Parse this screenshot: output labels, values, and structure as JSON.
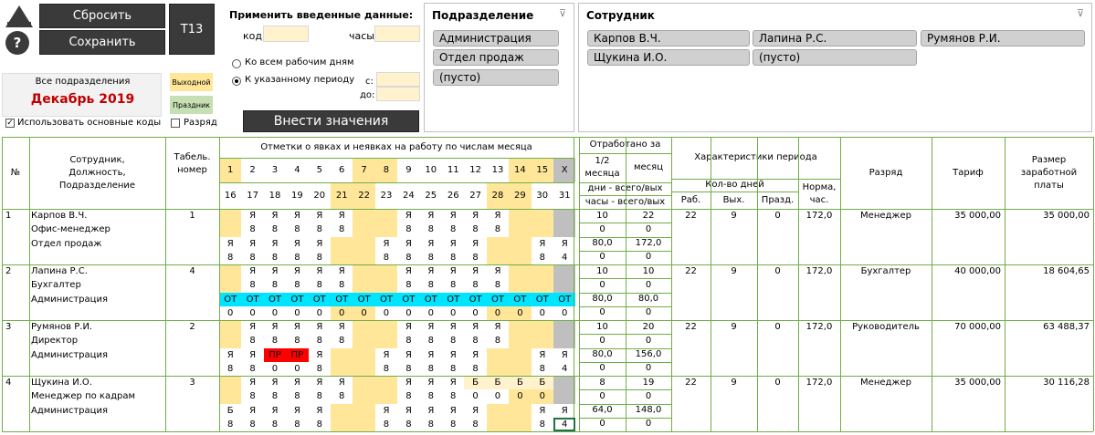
{
  "controls": {
    "reset_label": "Сбросить",
    "save_label": "Сохранить",
    "t13_label": "Т13",
    "help_label": "?"
  },
  "apply_panel": {
    "title": "Применить введенные данные:",
    "code_label": "код:",
    "hours_label": "часы:",
    "radio_all": "Ко всем рабочим дням",
    "radio_period": "К указанному периоду",
    "from_label": "с:",
    "to_label": "до:",
    "submit_label": "Внести значения"
  },
  "period_box": {
    "all_departments": "Все подразделения",
    "month": "Декабрь 2019",
    "weekend_label": "Выходной",
    "holiday_label": "Праздник",
    "use_codes_label": "Использовать основные коды",
    "use_codes_checked": true,
    "grade_label": "Разряд",
    "grade_checked": false
  },
  "department_slicer": {
    "title": "Подразделение",
    "items": [
      "Администрация",
      "Отдел продаж",
      "(пусто)"
    ]
  },
  "employee_slicer": {
    "title": "Сотрудник",
    "items": [
      "Карпов В.Ч.",
      "Лапина Р.С.",
      "Румянов Р.И.",
      "Щукина И.О.",
      "(пусто)"
    ]
  },
  "table": {
    "headers": {
      "num": "№",
      "employee": "Сотрудник,\nДолжность,\nПодразделение",
      "tab_num": "Табель.\nномер",
      "marks": "Отметки о явках и неявках на работу по числам месяца",
      "worked": "Отработано за",
      "half": "1/2\nмесяца",
      "month": "месяц",
      "days_total": "дни - всего/вых",
      "hours_total": "часы - всего/вых",
      "period": "Характеристики периода",
      "days_count": "Кол-во дней",
      "work": "Раб.",
      "off": "Вых.",
      "hol": "Празд.",
      "norm": "Норма,\nчас.",
      "grade": "Разряд",
      "tariff": "Тариф",
      "salary": "Размер\nзаработной\nплаты"
    },
    "days_row1": [
      "1",
      "2",
      "3",
      "4",
      "5",
      "6",
      "7",
      "8",
      "9",
      "10",
      "11",
      "12",
      "13",
      "14",
      "15",
      "X"
    ],
    "days_row2": [
      "16",
      "17",
      "18",
      "19",
      "20",
      "21",
      "22",
      "23",
      "24",
      "25",
      "26",
      "27",
      "28",
      "29",
      "30",
      "31"
    ],
    "employees": [
      {
        "num": "1",
        "name": "Карпов В.Ч.",
        "position": "Офис-менеджер",
        "department": "Отдел продаж",
        "tab": "1",
        "r1": [
          "",
          "Я",
          "Я",
          "Я",
          "Я",
          "Я",
          "",
          "",
          "Я",
          "Я",
          "Я",
          "Я",
          "Я",
          "",
          "",
          ""
        ],
        "r2": [
          "",
          "8",
          "8",
          "8",
          "8",
          "8",
          "",
          "",
          "8",
          "8",
          "8",
          "8",
          "8",
          "",
          "",
          ""
        ],
        "r3": [
          "Я",
          "Я",
          "Я",
          "Я",
          "Я",
          "",
          "",
          "Я",
          "Я",
          "Я",
          "Я",
          "Я",
          "",
          "",
          "Я",
          "Я"
        ],
        "r4": [
          "8",
          "8",
          "8",
          "8",
          "8",
          "",
          "",
          "8",
          "8",
          "8",
          "8",
          "8",
          "",
          "",
          "8",
          "4"
        ],
        "half_days": "10",
        "half_off": "0",
        "half_hours": "80,0",
        "half_hours_off": "0",
        "month_days": "22",
        "month_off": "0",
        "month_hours": "172,0",
        "month_hours_off": "0",
        "work": "22",
        "off": "9",
        "hol": "0",
        "norm": "172,0",
        "grade": "Менеджер",
        "tariff": "35 000,00",
        "salary": "35 000,00"
      },
      {
        "num": "2",
        "name": "Лапина Р.С.",
        "position": "Бухгалтер",
        "department": "Администрация",
        "tab": "4",
        "r1": [
          "",
          "Я",
          "Я",
          "Я",
          "Я",
          "Я",
          "",
          "",
          "Я",
          "Я",
          "Я",
          "Я",
          "Я",
          "",
          "",
          ""
        ],
        "r2": [
          "",
          "8",
          "8",
          "8",
          "8",
          "8",
          "",
          "",
          "8",
          "8",
          "8",
          "8",
          "8",
          "",
          "",
          ""
        ],
        "r3": [
          "ОТ",
          "ОТ",
          "ОТ",
          "ОТ",
          "ОТ",
          "ОТ",
          "ОТ",
          "ОТ",
          "ОТ",
          "ОТ",
          "ОТ",
          "ОТ",
          "ОТ",
          "ОТ",
          "ОТ",
          "ОТ"
        ],
        "r4": [
          "0",
          "0",
          "0",
          "0",
          "0",
          "0",
          "0",
          "0",
          "0",
          "0",
          "0",
          "0",
          "0",
          "0",
          "0",
          "0"
        ],
        "half_days": "10",
        "half_off": "0",
        "half_hours": "80,0",
        "half_hours_off": "0",
        "month_days": "10",
        "month_off": "0",
        "month_hours": "80,0",
        "month_hours_off": "0",
        "work": "22",
        "off": "9",
        "hol": "0",
        "norm": "172,0",
        "grade": "Бухгалтер",
        "tariff": "40 000,00",
        "salary": "18 604,65"
      },
      {
        "num": "3",
        "name": "Румянов Р.И.",
        "position": "Директор",
        "department": "Администрация",
        "tab": "2",
        "r1": [
          "",
          "Я",
          "Я",
          "Я",
          "Я",
          "Я",
          "",
          "",
          "Я",
          "Я",
          "Я",
          "Я",
          "Я",
          "",
          "",
          ""
        ],
        "r2": [
          "",
          "8",
          "8",
          "8",
          "8",
          "8",
          "",
          "",
          "8",
          "8",
          "8",
          "8",
          "8",
          "",
          "",
          ""
        ],
        "r3": [
          "Я",
          "Я",
          "ПР",
          "ПР",
          "Я",
          "",
          "",
          "Я",
          "Я",
          "Я",
          "Я",
          "Я",
          "",
          "",
          "Я",
          "Я"
        ],
        "r4": [
          "8",
          "8",
          "0",
          "0",
          "8",
          "",
          "",
          "8",
          "8",
          "8",
          "8",
          "8",
          "",
          "",
          "8",
          "4"
        ],
        "half_days": "10",
        "half_off": "0",
        "half_hours": "80,0",
        "half_hours_off": "0",
        "month_days": "20",
        "month_off": "0",
        "month_hours": "156,0",
        "month_hours_off": "0",
        "work": "22",
        "off": "9",
        "hol": "0",
        "norm": "172,0",
        "grade": "Руководитель",
        "tariff": "70 000,00",
        "salary": "63 488,37"
      },
      {
        "num": "4",
        "name": "Щукина И.О.",
        "position": "Менеджер по кадрам",
        "department": "Администрация",
        "tab": "3",
        "r1": [
          "",
          "Я",
          "Я",
          "Я",
          "Я",
          "Я",
          "",
          "",
          "Я",
          "Я",
          "Я",
          "Б",
          "Б",
          "Б",
          "Б",
          ""
        ],
        "r2": [
          "",
          "8",
          "8",
          "8",
          "8",
          "8",
          "",
          "",
          "8",
          "8",
          "8",
          "0",
          "0",
          "0",
          "0",
          ""
        ],
        "r3": [
          "Б",
          "Я",
          "Я",
          "Я",
          "Я",
          "",
          "",
          "Я",
          "Я",
          "Я",
          "Я",
          "Я",
          "",
          "",
          "Я",
          "Я"
        ],
        "r4": [
          "8",
          "8",
          "8",
          "8",
          "8",
          "",
          "",
          "8",
          "8",
          "8",
          "8",
          "8",
          "",
          "",
          "8",
          "4"
        ],
        "half_days": "8",
        "half_off": "0",
        "half_hours": "64,0",
        "half_hours_off": "0",
        "month_days": "19",
        "month_off": "0",
        "month_hours": "148,0",
        "month_hours_off": "0",
        "work": "22",
        "off": "9",
        "hol": "0",
        "norm": "172,0",
        "grade": "Менеджер",
        "tariff": "35 000,00",
        "salary": "30 116,28"
      }
    ]
  }
}
